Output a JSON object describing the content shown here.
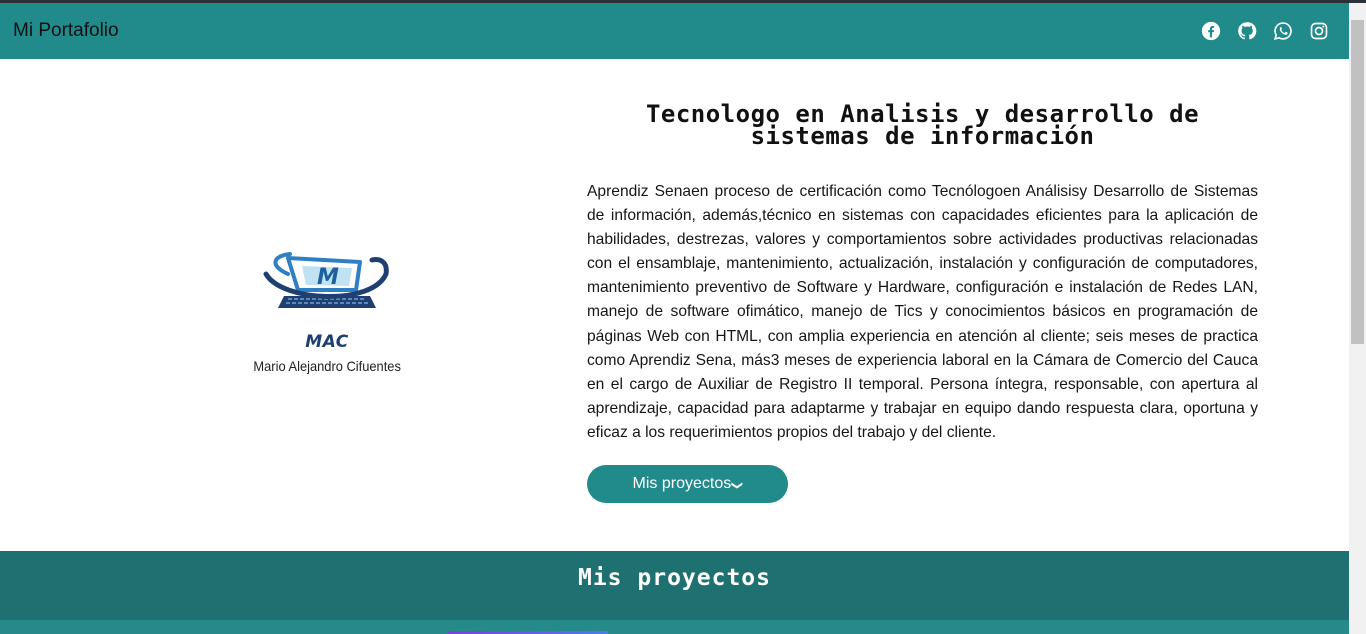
{
  "navbar": {
    "brand": "Mi Portafolio",
    "social": [
      "facebook-icon",
      "github-icon",
      "whatsapp-icon",
      "instagram-icon"
    ]
  },
  "hero": {
    "logo": {
      "mark": "MAC",
      "name": "Mario Alejandro Cifuentes"
    },
    "title": "Tecnologo en Analisis y desarrollo de sistemas de información",
    "description": "Aprendiz Senaen proceso de certificación como Tecnólogoen Análisisy Desarrollo de Sistemas de información, además,técnico en sistemas con capacidades eficientes para la aplicación de habilidades, destrezas, valores y comportamientos sobre actividades productivas relacionadas con el ensamblaje, mantenimiento, actualización, instalación y configuración de computadores, mantenimiento preventivo de Software y Hardware, configuración e instalación de Redes LAN, manejo de software ofimático, manejo de Tics y conocimientos básicos en programación de páginas Web con HTML, con amplia experiencia en atención al cliente; seis meses de practica como Aprendiz Sena, más3 meses de experiencia laboral en la Cámara de Comercio del Cauca en el cargo de Auxiliar de Registro II temporal. Persona íntegra, responsable, con apertura al aprendizaje, capacidad para adaptarme y trabajar en equipo dando respuesta clara, oportuna y eficaz a los requerimientos propios del trabajo y del cliente.",
    "button_label": "Mis proyectos"
  },
  "projects": {
    "title": "Mis proyectos"
  },
  "colors": {
    "navbar": "#218a8a",
    "section": "#1f7070",
    "button": "#218a8a"
  }
}
